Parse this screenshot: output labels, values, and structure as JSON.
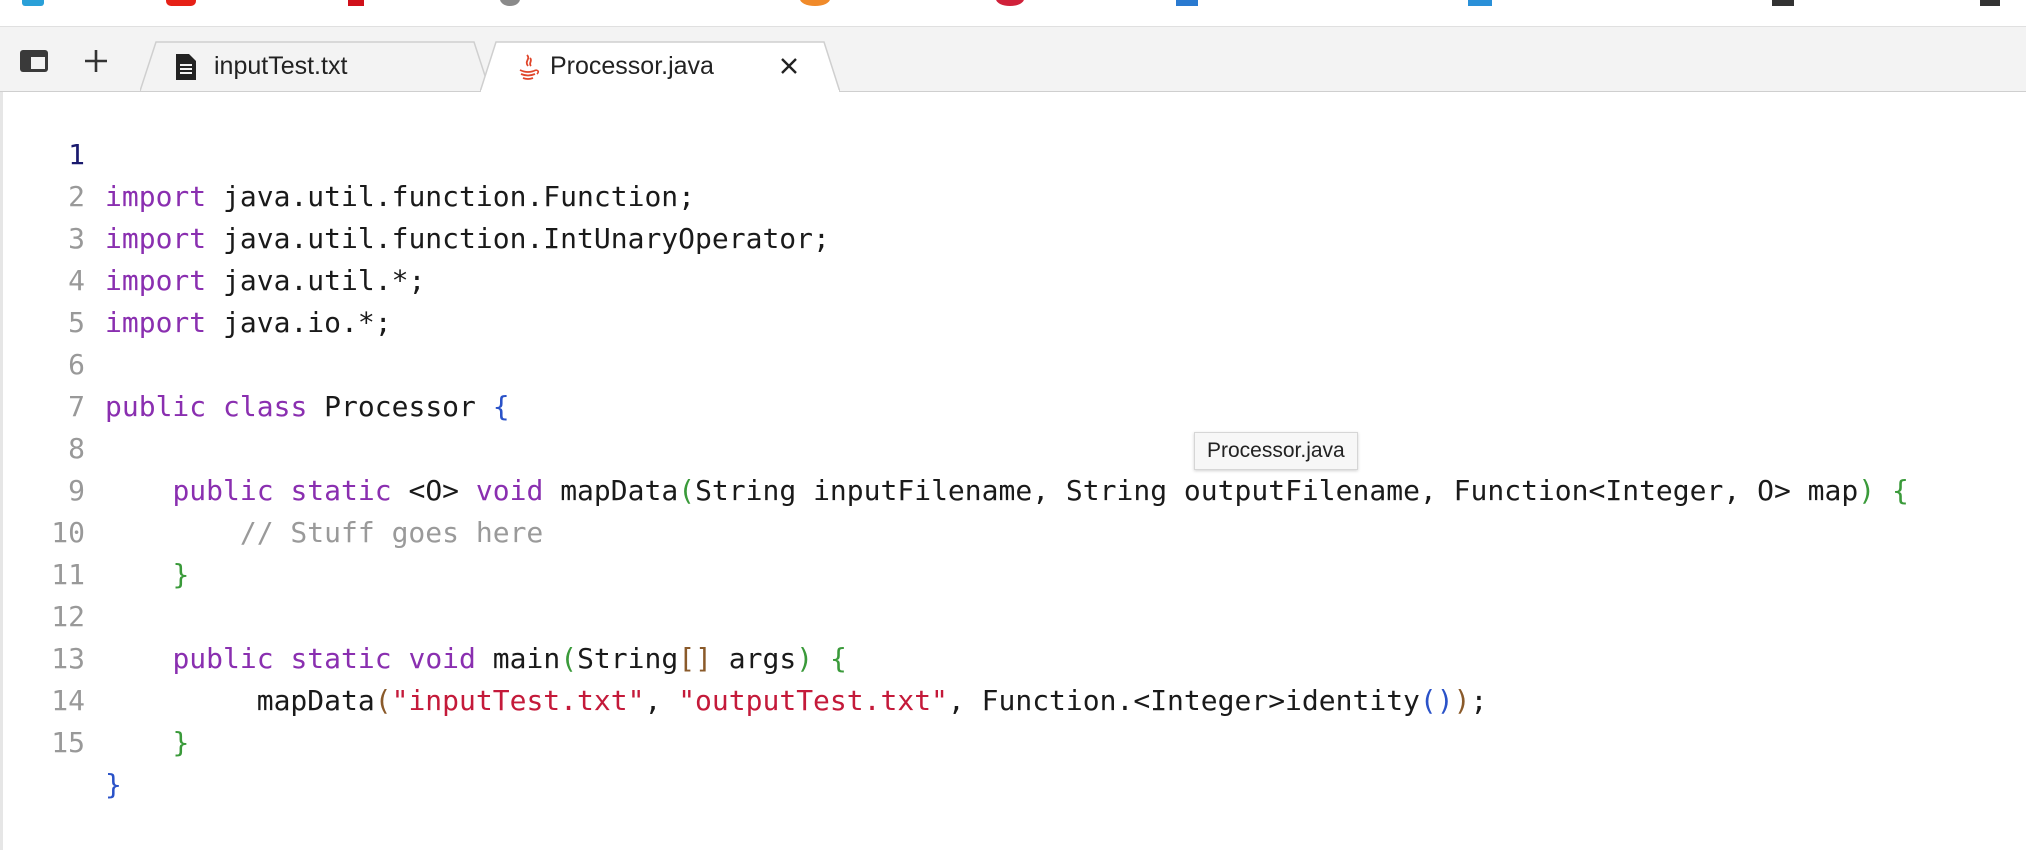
{
  "toolbar": {
    "sidebar_icon": "sidebar-toggle-icon",
    "new_tab_icon": "plus-icon"
  },
  "tabs": [
    {
      "label": "inputTest.txt",
      "icon": "text-file-icon",
      "active": false
    },
    {
      "label": "Processor.java",
      "icon": "java-file-icon",
      "active": true,
      "close_icon": "close-icon"
    }
  ],
  "editor": {
    "active_line": 1,
    "lines": [
      {
        "n": "1"
      },
      {
        "n": "2"
      },
      {
        "n": "3"
      },
      {
        "n": "4"
      },
      {
        "n": "5"
      },
      {
        "n": "6"
      },
      {
        "n": "7"
      },
      {
        "n": "8"
      },
      {
        "n": "9"
      },
      {
        "n": "10"
      },
      {
        "n": "11"
      },
      {
        "n": "12"
      },
      {
        "n": "13"
      },
      {
        "n": "14"
      },
      {
        "n": "15"
      }
    ],
    "code": {
      "l1": {
        "kw": "import",
        "rest": " java.util.function.Function;"
      },
      "l2": {
        "kw": "import",
        "rest": " java.util.function.IntUnaryOperator;"
      },
      "l3": {
        "kw": "import",
        "rest": " java.util.*;"
      },
      "l4": {
        "kw": "import",
        "rest": " java.io.*;"
      },
      "l6": {
        "kw1": "public",
        "kw2": "class",
        "name": " Processor ",
        "brace": "{"
      },
      "l8": {
        "kw1": "public",
        "kw2": "static",
        "gen": " <O> ",
        "kw3": "void",
        "name": " mapData",
        "open": "(",
        "params": "String inputFilename, String outputFilename, Function<Integer, O> map",
        "close": ")",
        "brace": " {"
      },
      "l9": {
        "comment": "// Stuff goes here"
      },
      "l10": {
        "brace": "}"
      },
      "l12": {
        "kw1": "public",
        "kw2": "static",
        "kw3": "void",
        "name": " main",
        "open": "(",
        "params": "String",
        "arr": "[]",
        "params2": " args",
        "close": ")",
        "brace": " {"
      },
      "l13": {
        "call": "mapData",
        "open": "(",
        "s1": "\"inputTest.txt\"",
        "sep1": ", ",
        "s2": "\"outputTest.txt\"",
        "mid": ", Function.<Integer>identity",
        "p": "()",
        "close": ")",
        "end": ";"
      },
      "l14": {
        "brace": "}"
      },
      "l15": {
        "brace": "}"
      }
    }
  },
  "tooltip": {
    "text": "Processor.java"
  }
}
